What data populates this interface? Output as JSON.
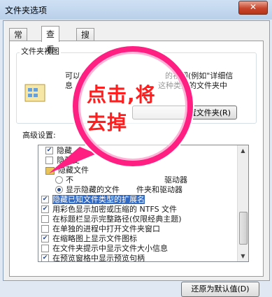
{
  "window": {
    "title": "文件夹选项",
    "close_label": "✕"
  },
  "tabs": [
    {
      "label": "常规",
      "active": false
    },
    {
      "label": "查看",
      "active": true
    },
    {
      "label": "搜索",
      "active": false
    }
  ],
  "folder_view": {
    "title": "文件夹视图",
    "description_line1": "可以将",
    "description_line1b": "的视图(例如\"详细信",
    "description_line2": "息",
    "description_line2b": "这种类型的文件夹中",
    "reset_button": "置文件夹(R)"
  },
  "advanced": {
    "label": "高级设置:",
    "items": [
      {
        "type": "checkbox",
        "checked": true,
        "text": "隐藏"
      },
      {
        "type": "checkbox",
        "checked": false,
        "text": "隐藏受"
      },
      {
        "type": "folder",
        "text": "隐藏文件"
      },
      {
        "type": "radio",
        "checked": false,
        "text": "不",
        "suffix": "驱动器"
      },
      {
        "type": "radio",
        "checked": true,
        "text": "显示隐藏的文件",
        "suffix": "件夹和驱动器"
      },
      {
        "type": "checkbox",
        "checked": true,
        "selected": true,
        "text": "隐藏已知文件类型的扩展名"
      },
      {
        "type": "checkbox",
        "checked": true,
        "text": "用彩色显示加密或压缩的 NTFS 文件"
      },
      {
        "type": "checkbox",
        "checked": false,
        "text": "在标题栏显示完整路径(仅限经典主题)"
      },
      {
        "type": "checkbox",
        "checked": false,
        "text": "在单独的进程中打开文件夹窗口"
      },
      {
        "type": "checkbox",
        "checked": true,
        "text": "在缩略图上显示文件图标"
      },
      {
        "type": "checkbox",
        "checked": false,
        "text": "在文件夹提示中显示文件大小信息"
      },
      {
        "type": "checkbox",
        "checked": true,
        "text": "在预览窗格中显示预览句柄"
      }
    ]
  },
  "restore_button": "还原为默认值(D)",
  "annotation": {
    "line1": "点击,将",
    "line2": "去掉",
    "color": "#ff1d1d",
    "ring_color": "#ff1f82"
  }
}
